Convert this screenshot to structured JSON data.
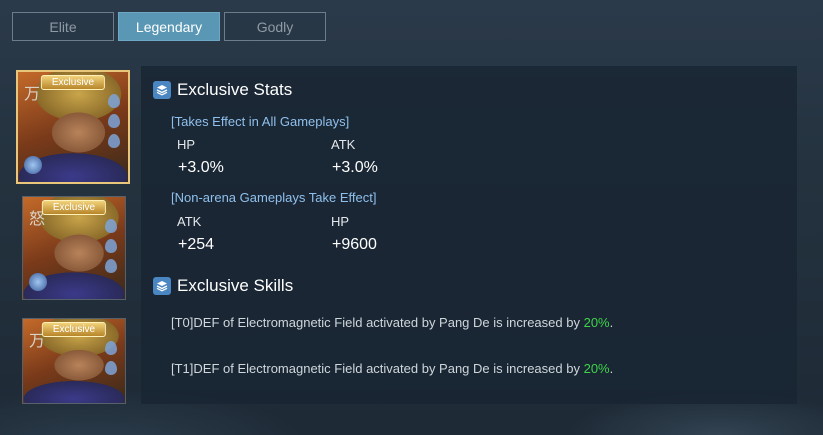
{
  "tabs": [
    {
      "label": "Elite",
      "active": false
    },
    {
      "label": "Legendary",
      "active": true
    },
    {
      "label": "Godly",
      "active": false
    }
  ],
  "portraits": [
    {
      "badge": "Exclusive",
      "mark": "万",
      "selected": true
    },
    {
      "badge": "Exclusive",
      "mark": "怒",
      "selected": false
    },
    {
      "badge": "Exclusive",
      "mark": "万",
      "selected": false
    }
  ],
  "stats": {
    "title": "Exclusive Stats",
    "group1": {
      "condition": "[Takes Effect in All Gameplays]",
      "label_a": "HP",
      "value_a": "+3.0%",
      "label_b": "ATK",
      "value_b": "+3.0%"
    },
    "group2": {
      "condition": "[Non-arena Gameplays Take Effect]",
      "label_a": "ATK",
      "value_a": "+254",
      "label_b": "HP",
      "value_b": "+9600"
    }
  },
  "skills": {
    "title": "Exclusive Skills",
    "items": [
      {
        "text": "[T0]DEF of Electromagnetic Field activated by Pang De is increased by ",
        "highlight": "20%",
        "suffix": "."
      },
      {
        "text": "[T1]DEF of Electromagnetic Field activated by Pang De is increased by ",
        "highlight": "20%",
        "suffix": "."
      }
    ]
  },
  "colors": {
    "accent_tab": "#5a97b4",
    "highlight": "#3fd34a",
    "condition": "#8fc0ec",
    "frame_gold": "#e8c77a"
  }
}
